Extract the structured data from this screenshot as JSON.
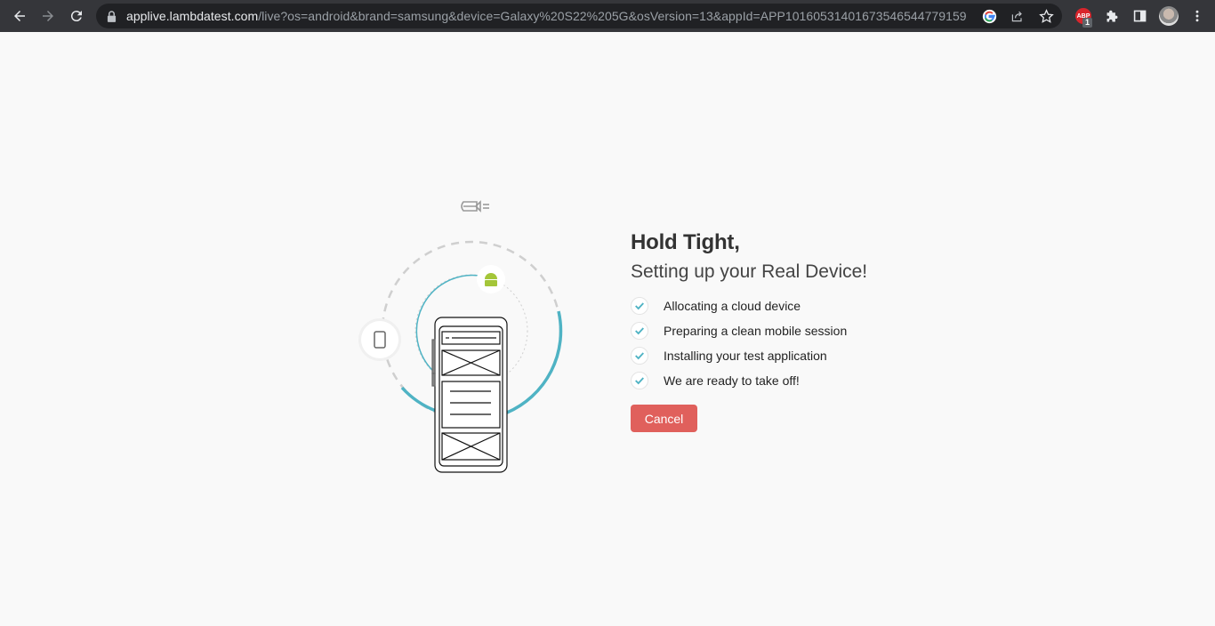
{
  "browser": {
    "url_host": "applive.lambdatest.com",
    "url_path": "/live?os=android&brand=samsung&device=Galaxy%20S22%205G&osVersion=13&appId=APP1016053140167354654477915 9",
    "extension_badge": "1",
    "abp_label": "ABP",
    "icons": [
      "back-icon",
      "forward-icon",
      "reload-icon",
      "lock-icon",
      "google-icon",
      "share-icon",
      "star-icon",
      "adblock-icon",
      "extensions-icon",
      "side-panel-icon",
      "profile-avatar",
      "menu-icon"
    ]
  },
  "page": {
    "title": "Hold Tight,",
    "subtitle": "Setting up your Real Device!",
    "steps": [
      {
        "label": "Allocating a cloud device",
        "done": true
      },
      {
        "label": "Preparing a clean mobile session",
        "done": true
      },
      {
        "label": "Installing your test application",
        "done": true
      },
      {
        "label": "We are ready to take off!",
        "done": true
      }
    ],
    "cancel_label": "Cancel",
    "colors": {
      "accent": "#4fb3c4",
      "cancel": "#e0605c",
      "android": "#a4c639"
    }
  }
}
